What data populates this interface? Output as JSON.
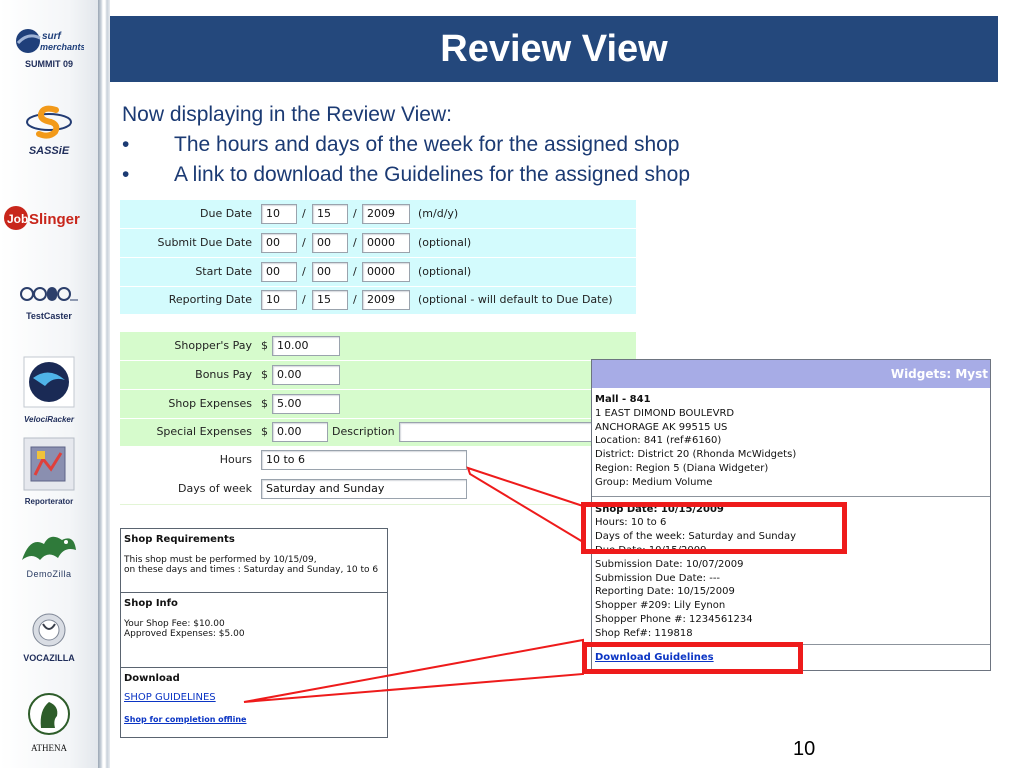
{
  "sidebar": {
    "logos": [
      {
        "name": "surf-merchants-logo",
        "caption": "SUMMIT 09",
        "wordmark": "Surf merchants"
      },
      {
        "name": "sassie-logo",
        "caption": "SASSiE"
      },
      {
        "name": "jobslinger-logo",
        "caption": "JobSlinger"
      },
      {
        "name": "testcaster-logo",
        "caption": "TestCaster"
      },
      {
        "name": "velociracker-logo",
        "caption": "VelociRacker"
      },
      {
        "name": "reporterator-logo",
        "caption": "Reporterator"
      },
      {
        "name": "demozilla-logo",
        "caption": "DemoZilla"
      },
      {
        "name": "vocazilla-logo",
        "caption": "VOCAZILLA"
      },
      {
        "name": "athena-logo",
        "caption": "ATHENA"
      }
    ]
  },
  "header": {
    "title": "Review View"
  },
  "intro": {
    "lead": "Now displaying in the Review View:",
    "bullets": [
      "The hours and days of the week for the assigned shop",
      "A link to download the Guidelines for the assigned shop"
    ],
    "bullet_char": "•"
  },
  "dates_form": {
    "rows": [
      {
        "label": "Due Date",
        "m": "10",
        "d": "15",
        "y": "2009",
        "note": "(m/d/y)"
      },
      {
        "label": "Submit Due Date",
        "m": "00",
        "d": "00",
        "y": "0000",
        "note": "(optional)"
      },
      {
        "label": "Start Date",
        "m": "00",
        "d": "00",
        "y": "0000",
        "note": "(optional)"
      },
      {
        "label": "Reporting Date",
        "m": "10",
        "d": "15",
        "y": "2009",
        "note": "(optional - will default to Due Date)"
      }
    ],
    "slash": "/"
  },
  "pay_form": {
    "currency": "$",
    "shoppers_pay": {
      "label": "Shopper's Pay",
      "value": "10.00"
    },
    "bonus_pay": {
      "label": "Bonus Pay",
      "value": "0.00"
    },
    "shop_expenses": {
      "label": "Shop Expenses",
      "value": "5.00"
    },
    "special_expenses": {
      "label": "Special Expenses",
      "value": "0.00",
      "description_label": "Description",
      "description_value": ""
    },
    "hours": {
      "label": "Hours",
      "value": "10 to 6"
    },
    "days_of_week": {
      "label": "Days of week",
      "value": "Saturday and Sunday"
    }
  },
  "requirements": {
    "shop_requirements": {
      "title": "Shop Requirements",
      "line1": "This shop must be performed by 10/15/09,",
      "line2": "on these days and times : Saturday and Sunday, 10 to 6"
    },
    "shop_info": {
      "title": "Shop Info",
      "fee": "Your Shop Fee: $10.00",
      "expenses": "Approved Expenses: $5.00"
    },
    "download": {
      "title": "Download",
      "guidelines_link": "SHOP GUIDELINES",
      "offline_link": "Shop for completion offline"
    }
  },
  "widgets_panel": {
    "title": "Widgets: Myst",
    "location": {
      "name": "Mall - 841",
      "address1": "1 EAST DIMOND BOULEVRD",
      "address2": "ANCHORAGE AK 99515 US",
      "location": "Location: 841 (ref#6160)",
      "district": "District: District 20 (Rhonda McWidgets)",
      "region": "Region: Region 5 (Diana Widgeter)",
      "group": "Group: Medium Volume"
    },
    "shop": {
      "shop_date": "Shop Date: 10/15/2009",
      "hours": "Hours: 10 to 6",
      "days": "Days of the week: Saturday and Sunday",
      "due_date": "Due Date: 10/15/2009",
      "submission_date": "Submission Date: 10/07/2009",
      "submission_due": "Submission Due Date: ---",
      "reporting_date": "Reporting Date: 10/15/2009",
      "shopper": "Shopper #209: Lily Eynon",
      "shopper_phone": "Shopper Phone #: 1234561234",
      "shop_ref": "Shop Ref#: 119818"
    },
    "download_link": "Download Guidelines"
  },
  "highlight_color": "#ee1b1b",
  "header_color": "#24487c",
  "page_number": "10"
}
